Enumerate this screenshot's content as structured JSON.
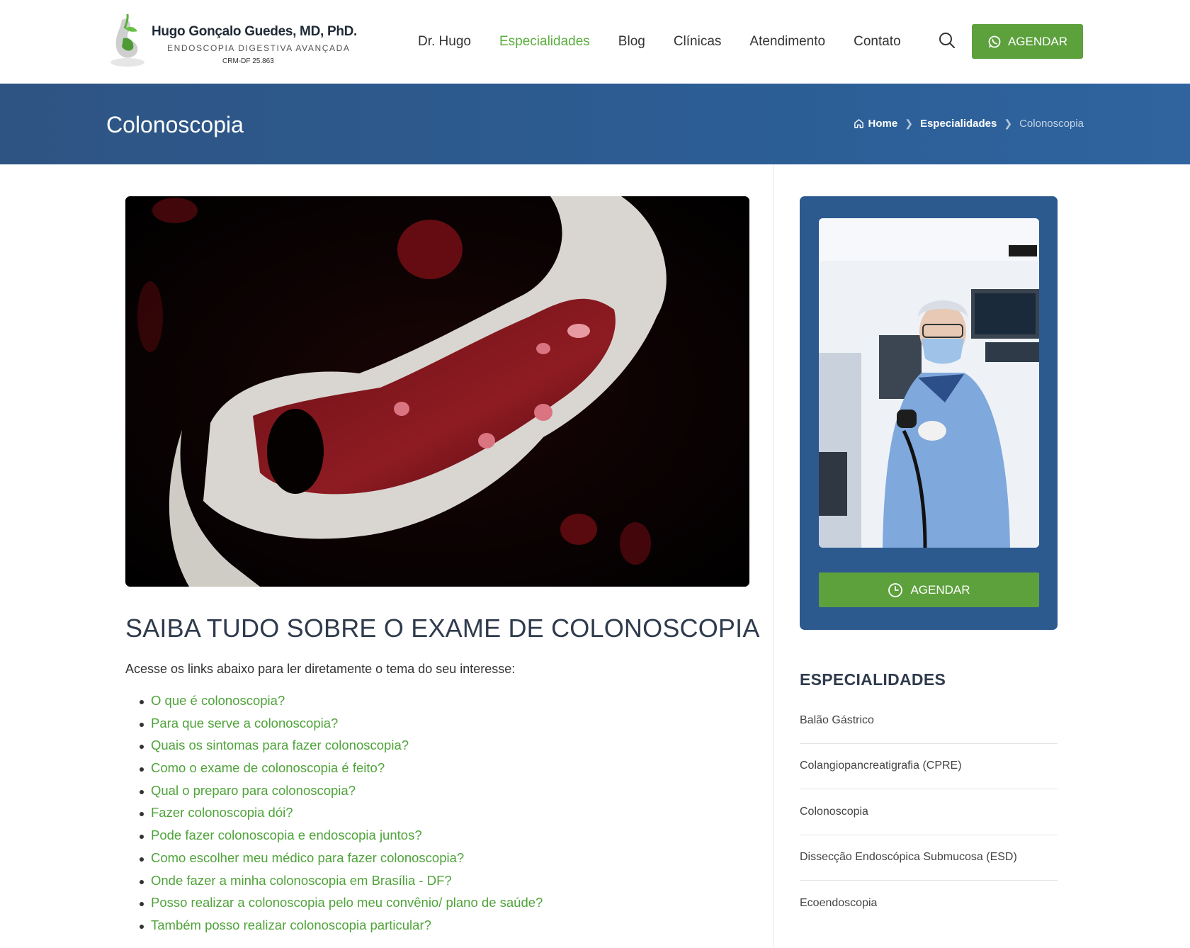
{
  "brand": {
    "name": "Hugo Gonçalo Guedes, MD, PhD.",
    "tagline": "ENDOSCOPIA DIGESTIVA AVANÇADA",
    "crm": "CRM-DF 25.863"
  },
  "nav": {
    "items": [
      {
        "label": "Dr. Hugo",
        "active": false
      },
      {
        "label": "Especialidades",
        "active": true
      },
      {
        "label": "Blog",
        "active": false
      },
      {
        "label": "Clínicas",
        "active": false
      },
      {
        "label": "Atendimento",
        "active": false
      },
      {
        "label": "Contato",
        "active": false
      }
    ],
    "cta_label": "AGENDAR"
  },
  "page": {
    "title": "Colonoscopia",
    "breadcrumb": [
      "Home",
      "Especialidades",
      "Colonoscopia"
    ]
  },
  "article": {
    "heading": "SAIBA TUDO SOBRE O EXAME DE COLONOSCOPIA",
    "intro": "Acesse os links abaixo para ler diretamente o tema do seu interesse:",
    "links": [
      "O que é colonoscopia?",
      "Para que serve a colonoscopia?",
      "Quais os sintomas para fazer colonoscopia?",
      "Como o exame de colonoscopia é feito?",
      "Qual o preparo para colonoscopia?",
      "Fazer colonoscopia dói?",
      "Pode fazer colonoscopia e endoscopia juntos?",
      "Como escolher meu médico para fazer colonoscopia?",
      "Onde fazer a minha colonoscopia em Brasília - DF?",
      "Posso realizar a colonoscopia pelo meu convênio/ plano de saúde?",
      "Também posso realizar colonoscopia particular?"
    ]
  },
  "sidebar": {
    "cta_label": "AGENDAR",
    "specialties_heading": "ESPECIALIDADES",
    "specialties": [
      "Balão Gástrico",
      "Colangiopancreatigrafia (CPRE)",
      "Colonoscopia",
      "Dissecção Endoscópica Submucosa (ESD)",
      "Ecoendoscopia"
    ]
  },
  "colors": {
    "accent_green": "#5da13d",
    "link_green": "#4fa33a",
    "band_blue": "#2c5d94"
  }
}
